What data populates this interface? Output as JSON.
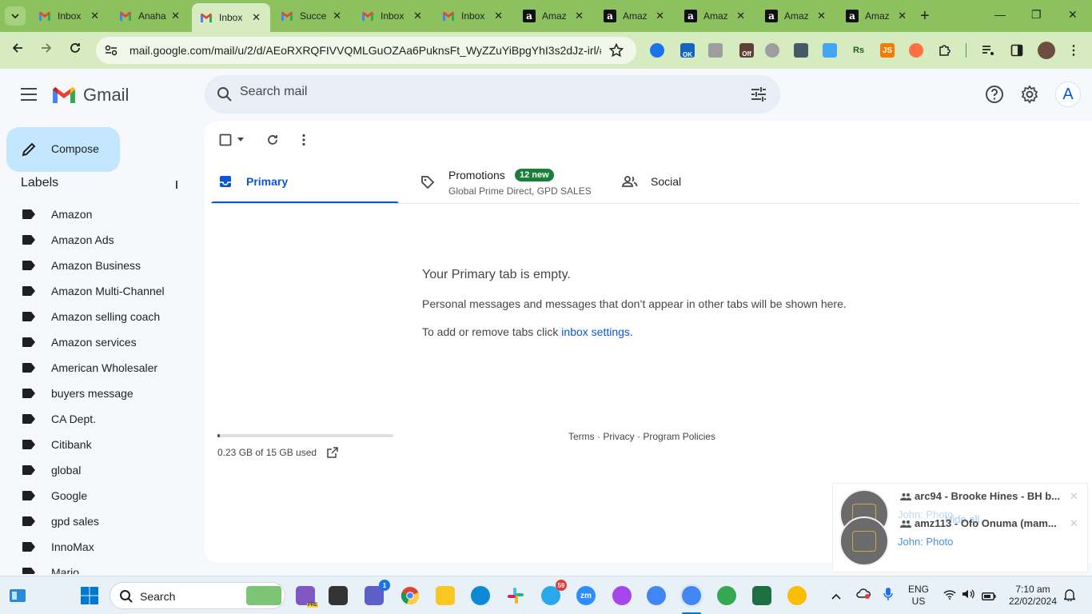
{
  "browser": {
    "tabs": [
      {
        "title": "Inbox",
        "icon": "gmail-icon"
      },
      {
        "title": "Anaha",
        "icon": "gmail-icon"
      },
      {
        "title": "Inbox",
        "icon": "gmail-icon",
        "active": true
      },
      {
        "title": "Succe",
        "icon": "gmail-icon"
      },
      {
        "title": "Inbox",
        "icon": "gmail-icon"
      },
      {
        "title": "Inbox",
        "icon": "gmail-icon"
      },
      {
        "title": "Amaz",
        "icon": "amazon-icon"
      },
      {
        "title": "Amaz",
        "icon": "amazon-icon"
      },
      {
        "title": "Amaz",
        "icon": "amazon-icon"
      },
      {
        "title": "Amaz",
        "icon": "amazon-icon"
      },
      {
        "title": "Amaz",
        "icon": "amazon-icon"
      }
    ],
    "url": "mail.google.com/mail/u/2/d/AEoRXRQFIVVQMLGuOZAa6PuknsFt_WyZZuYiBpgYhI3s2dJz-irl/#i...",
    "extension_badges": {
      "ok": "OK",
      "off": "Off",
      "rs": "Rs",
      "js": "JS"
    }
  },
  "gmail": {
    "brand": "Gmail",
    "search_placeholder": "Search mail",
    "avatar_letter": "A",
    "compose_label": "Compose",
    "labels_heading": "Labels",
    "labels": [
      "Amazon",
      "Amazon Ads",
      "Amazon Business",
      "Amazon Multi-Channel",
      "Amazon selling coach",
      "Amazon services",
      "American Wholesaler",
      "buyers message",
      "CA Dept.",
      "Citibank",
      "global",
      "Google",
      "gpd sales",
      "InnoMax",
      "Mario"
    ],
    "tabs": {
      "primary": "Primary",
      "promotions": "Promotions",
      "promotions_badge": "12 new",
      "promotions_sub": "Global Prime Direct, GPD SALES",
      "social": "Social"
    },
    "empty": {
      "title": "Your Primary tab is empty.",
      "line1": "Personal messages and messages that don’t appear in other tabs will be shown here.",
      "line2_prefix": "To add or remove tabs click ",
      "line2_link": "inbox settings",
      "line2_suffix": "."
    },
    "storage": {
      "text": "0.23 GB of 15 GB used",
      "used_fraction": 0.015
    },
    "footer": {
      "terms": "Terms",
      "privacy": "Privacy",
      "policies": "Program Policies",
      "sep": " · "
    }
  },
  "notifications": [
    {
      "title": "arc94 - Brooke Hines - BH b...",
      "sub": "John: Photo",
      "extra": "Hide all"
    },
    {
      "title": "amz113 - Ofo Onuma (mam...",
      "sub": "John: Photo"
    }
  ],
  "taskbar": {
    "search_label": "Search",
    "teams_badge": "1",
    "telegram_badge": "59",
    "zoom_label": "zm",
    "lang": "ENG",
    "region": "US",
    "time": "7:10 am",
    "date": "22/02/2024",
    "pre_badge": "PRE"
  }
}
